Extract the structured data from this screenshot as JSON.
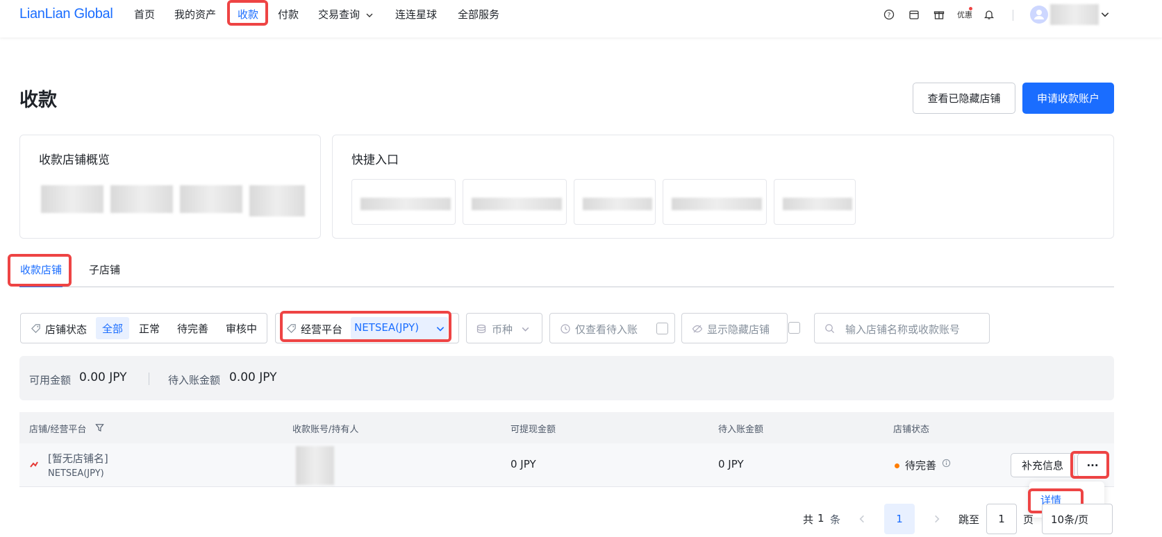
{
  "nav": {
    "logo": "LianLian Global",
    "items": [
      "首页",
      "我的资产",
      "收款",
      "付款",
      "交易查询",
      "连连星球",
      "全部服务"
    ],
    "chevron": "˅",
    "right_icons": [
      "help-icon",
      "calendar-icon",
      "gift-icon"
    ],
    "promo_label": "优惠",
    "bell_icon": "bell-icon"
  },
  "page": {
    "title": "收款",
    "hidden_stores_button": "查看已隐藏店铺",
    "apply_account_button": "申请收款账户"
  },
  "overview": {
    "title": "收款店铺概览"
  },
  "quick": {
    "title": "快捷入口"
  },
  "tabs": [
    "收款店铺",
    "子店铺"
  ],
  "filters": {
    "store_status_label": "店铺状态",
    "status_options": [
      "全部",
      "正常",
      "待完善",
      "审核中"
    ],
    "platform_label": "经营平台",
    "platform_value": "NETSEA(JPY)",
    "currency_label": "币种",
    "pending_only_label": "仅查看待入账",
    "show_hidden_label": "显示隐藏店铺",
    "search_placeholder": "输入店铺名称或收款账号"
  },
  "balance": {
    "available_label": "可用金额",
    "available_value": "0.00 JPY",
    "pending_label": "待入账金额",
    "pending_value": "0.00 JPY"
  },
  "table": {
    "headers": [
      "店铺/经营平台",
      "收款账号/持有人",
      "可提现金额",
      "待入账金额",
      "店铺状态"
    ],
    "rows": [
      {
        "store_name": "[暂无店铺名]",
        "platform": "NETSEA(JPY)",
        "withdrawable": "0 JPY",
        "pending": "0 JPY",
        "status": "待完善",
        "action_supplement": "补充信息",
        "action_more": "···"
      }
    ]
  },
  "popover": {
    "detail": "详情"
  },
  "pagination": {
    "total_prefix": "共",
    "total_count": "1",
    "total_suffix": "条",
    "current_page": "1",
    "jump_label": "跳至",
    "jump_value": "1",
    "page_suffix": "页",
    "page_size": "10条/页"
  },
  "colors": {
    "brand": "#1a6dff",
    "highlight": "#ee4444",
    "status_warning": "#ff7d00"
  }
}
